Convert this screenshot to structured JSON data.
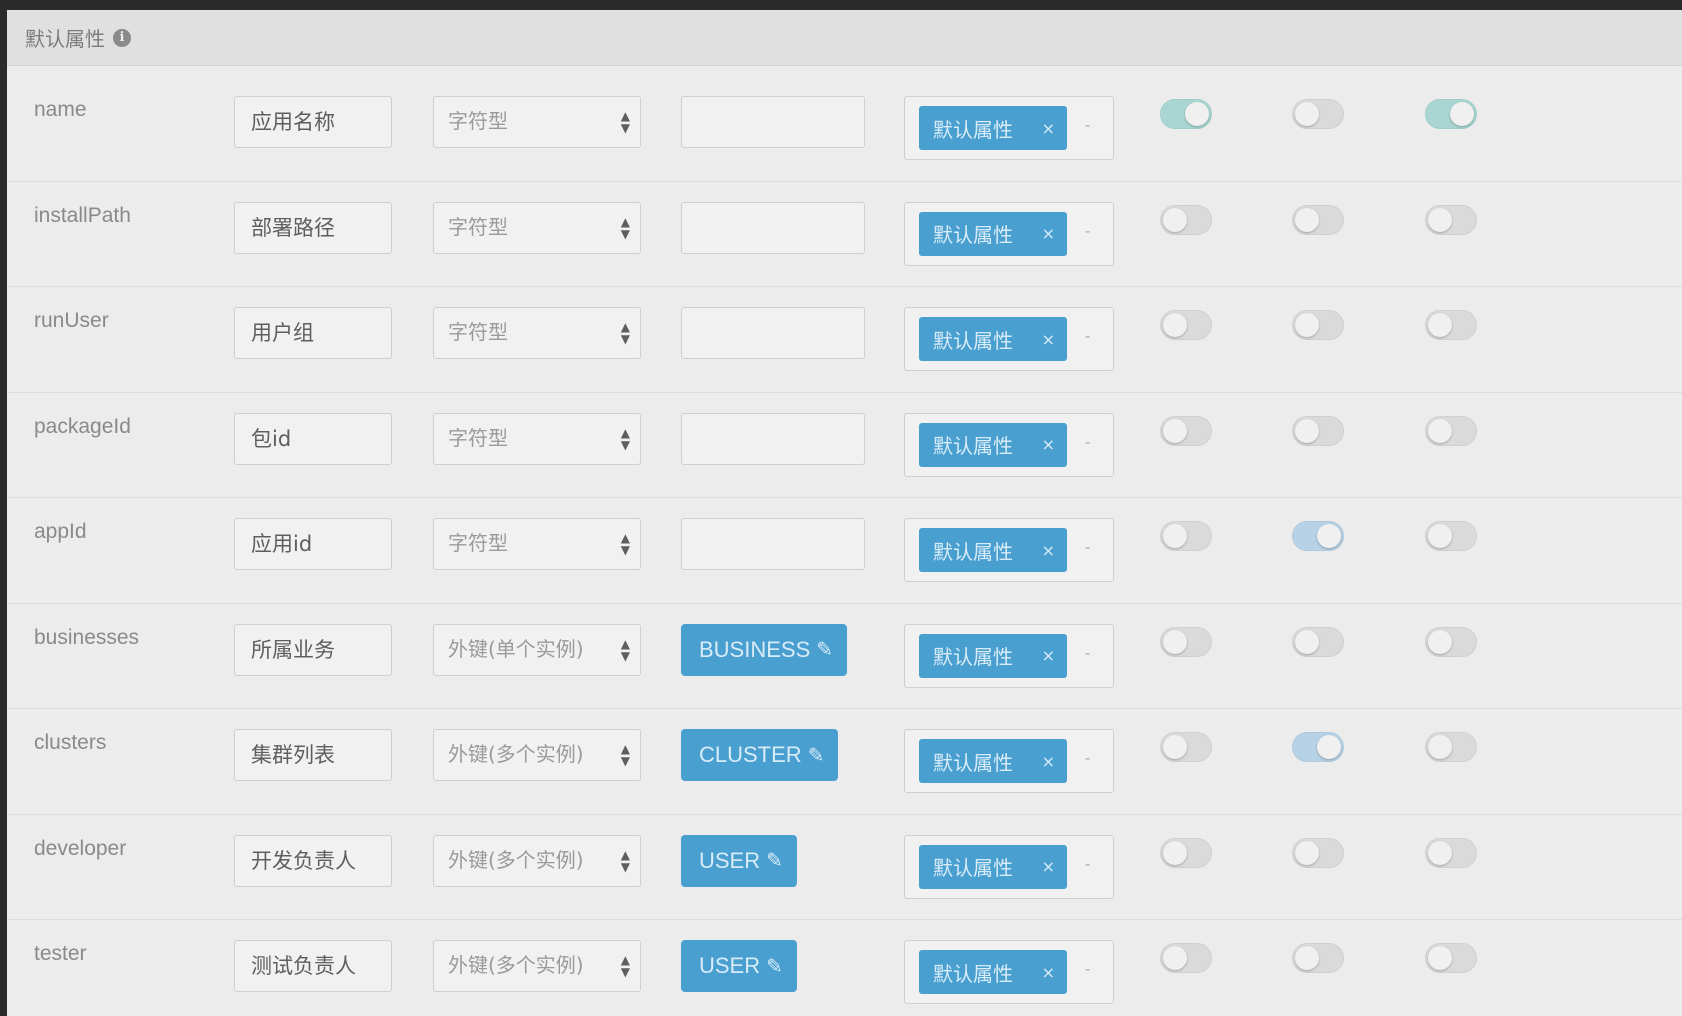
{
  "header": {
    "title": "默认属性",
    "info_icon": "info-circle-icon"
  },
  "tag_remove_glyph": "×",
  "rows": [
    {
      "name": "name",
      "display": "应用名称",
      "type": "字符型",
      "default_value": "",
      "fk_target": null,
      "tag": "默认属性",
      "toggles": [
        "on-teal",
        "off",
        "on-teal"
      ]
    },
    {
      "name": "installPath",
      "display": "部署路径",
      "type": "字符型",
      "default_value": "",
      "fk_target": null,
      "tag": "默认属性",
      "toggles": [
        "off",
        "off",
        "off"
      ]
    },
    {
      "name": "runUser",
      "display": "用户组",
      "type": "字符型",
      "default_value": "",
      "fk_target": null,
      "tag": "默认属性",
      "toggles": [
        "off",
        "off",
        "off"
      ]
    },
    {
      "name": "packageId",
      "display": "包id",
      "type": "字符型",
      "default_value": "",
      "fk_target": null,
      "tag": "默认属性",
      "toggles": [
        "off",
        "off",
        "off"
      ]
    },
    {
      "name": "appId",
      "display": "应用id",
      "type": "字符型",
      "default_value": "",
      "fk_target": null,
      "tag": "默认属性",
      "toggles": [
        "off",
        "on-blue",
        "off"
      ]
    },
    {
      "name": "businesses",
      "display": "所属业务",
      "type": "外键(单个实例)",
      "default_value": null,
      "fk_target": "BUSINESS",
      "tag": "默认属性",
      "toggles": [
        "off",
        "off",
        "off"
      ]
    },
    {
      "name": "clusters",
      "display": "集群列表",
      "type": "外键(多个实例)",
      "default_value": null,
      "fk_target": "CLUSTER",
      "tag": "默认属性",
      "toggles": [
        "off",
        "on-blue",
        "off"
      ]
    },
    {
      "name": "developer",
      "display": "开发负责人",
      "type": "外键(多个实例)",
      "default_value": null,
      "fk_target": "USER",
      "tag": "默认属性",
      "toggles": [
        "off",
        "off",
        "off"
      ]
    },
    {
      "name": "tester",
      "display": "测试负责人",
      "type": "外键(多个实例)",
      "default_value": null,
      "fk_target": "USER",
      "tag": "默认属性",
      "toggles": [
        "off",
        "off",
        "off"
      ]
    }
  ],
  "colors": {
    "accent": "#4a9fd1",
    "toggle_on_teal": "#a9d6d2",
    "toggle_on_blue": "#b7d2e6",
    "panel_bg": "#ececec",
    "frame_bg": "#2b2b2b"
  }
}
